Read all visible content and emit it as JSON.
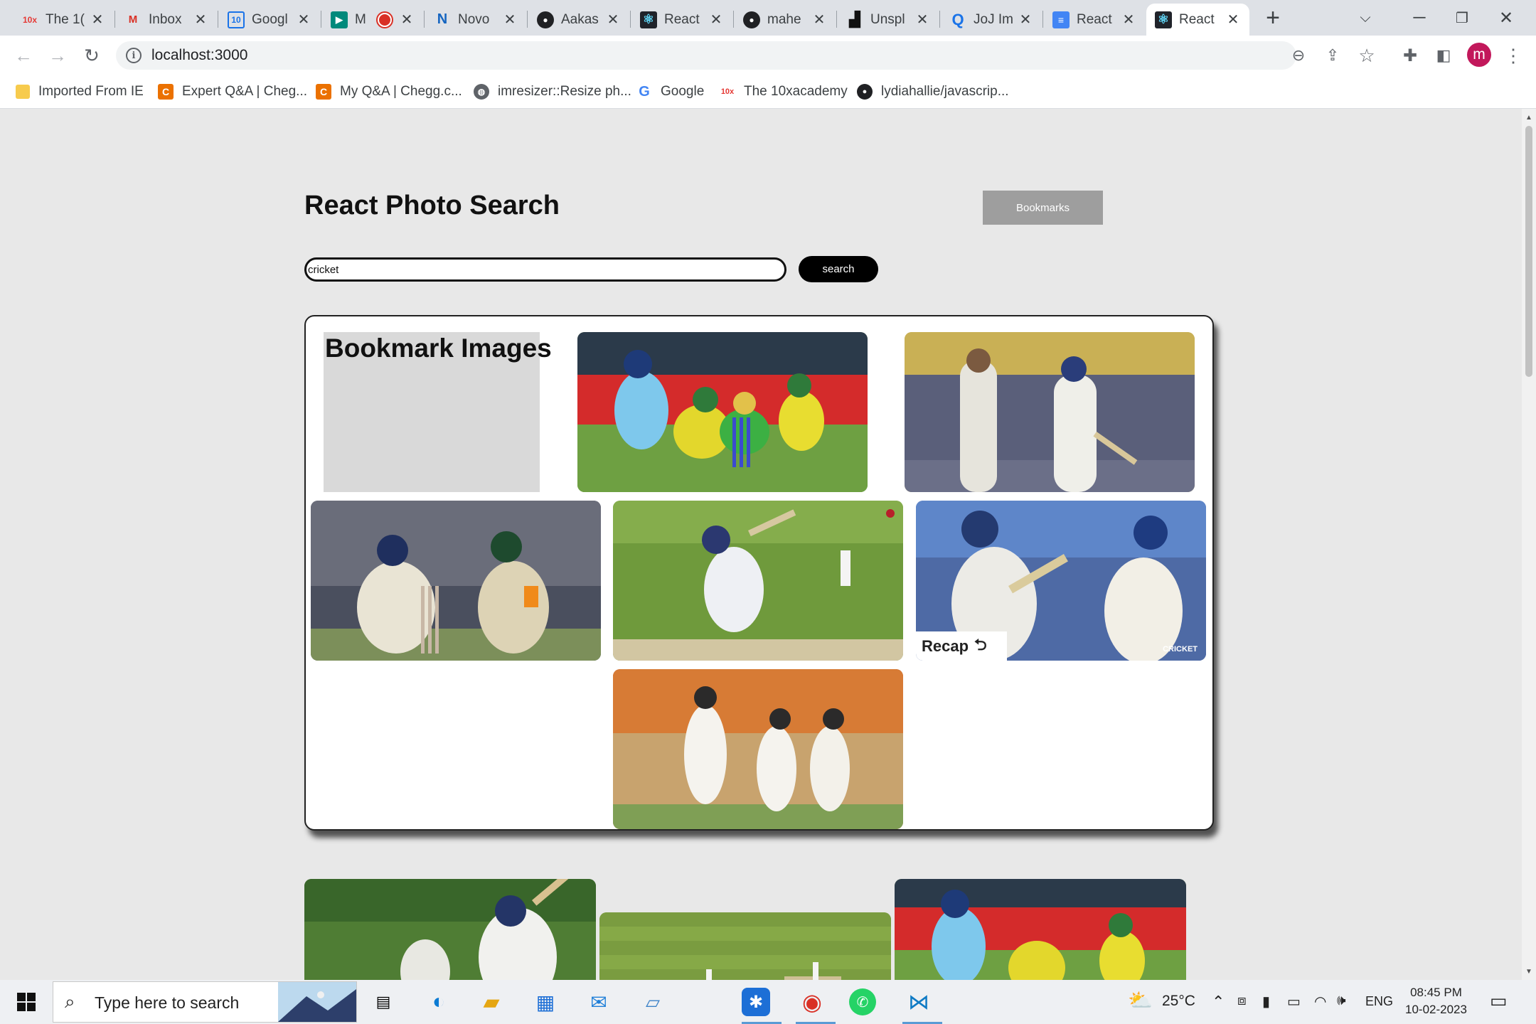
{
  "browser": {
    "tabs": [
      {
        "favicon": "10x-icon",
        "title": "The 1(",
        "active": false
      },
      {
        "favicon": "gmail-icon",
        "title": "Inbox",
        "active": false
      },
      {
        "favicon": "google-calendar-icon",
        "title": "Googl",
        "active": false
      },
      {
        "favicon": "google-meet-icon",
        "title": "M",
        "active": false
      },
      {
        "favicon": "novo-icon",
        "title": "Novo",
        "active": false
      },
      {
        "favicon": "github-icon",
        "title": "Aakas",
        "active": false
      },
      {
        "favicon": "react-icon",
        "title": "React",
        "active": false
      },
      {
        "favicon": "github-icon",
        "title": "mahe",
        "active": false
      },
      {
        "favicon": "unsplash-icon",
        "title": "Unspl",
        "active": false
      },
      {
        "favicon": "search-icon",
        "title": "JoJ Im",
        "active": false
      },
      {
        "favicon": "docs-icon",
        "title": "React",
        "active": false
      },
      {
        "favicon": "react-icon",
        "title": "React",
        "active": true
      }
    ],
    "url": "localhost:3000",
    "profile_initial": "m",
    "bookmarks": [
      {
        "icon": "folder-icon",
        "label": "Imported From IE"
      },
      {
        "icon": "chegg-icon",
        "label": "Expert Q&A | Cheg..."
      },
      {
        "icon": "chegg-icon",
        "label": "My Q&A | Chegg.c..."
      },
      {
        "icon": "globe-icon",
        "label": "imresizer::Resize ph..."
      },
      {
        "icon": "google-icon",
        "label": "Google"
      },
      {
        "icon": "10x-icon",
        "label": "The 10xacademy"
      },
      {
        "icon": "github-icon",
        "label": "lydiahallie/javascrip..."
      }
    ]
  },
  "app": {
    "title": "React Photo Search",
    "bookmarks_button": "Bookmarks",
    "search_value": "cricket",
    "search_button": "search",
    "bookmark_heading": "Bookmark Images",
    "recap_label": "Recap",
    "recap_logo": "CRICKET"
  },
  "taskbar": {
    "search_placeholder": "Type here to search",
    "temperature": "25°C",
    "language": "ENG",
    "time": "08:45 PM",
    "date": "10-02-2023"
  },
  "colors": {
    "page_bg": "#e8e8e8",
    "button_black": "#000000",
    "bookmarks_btn": "#9e9e9e",
    "panel_border": "#222222"
  }
}
